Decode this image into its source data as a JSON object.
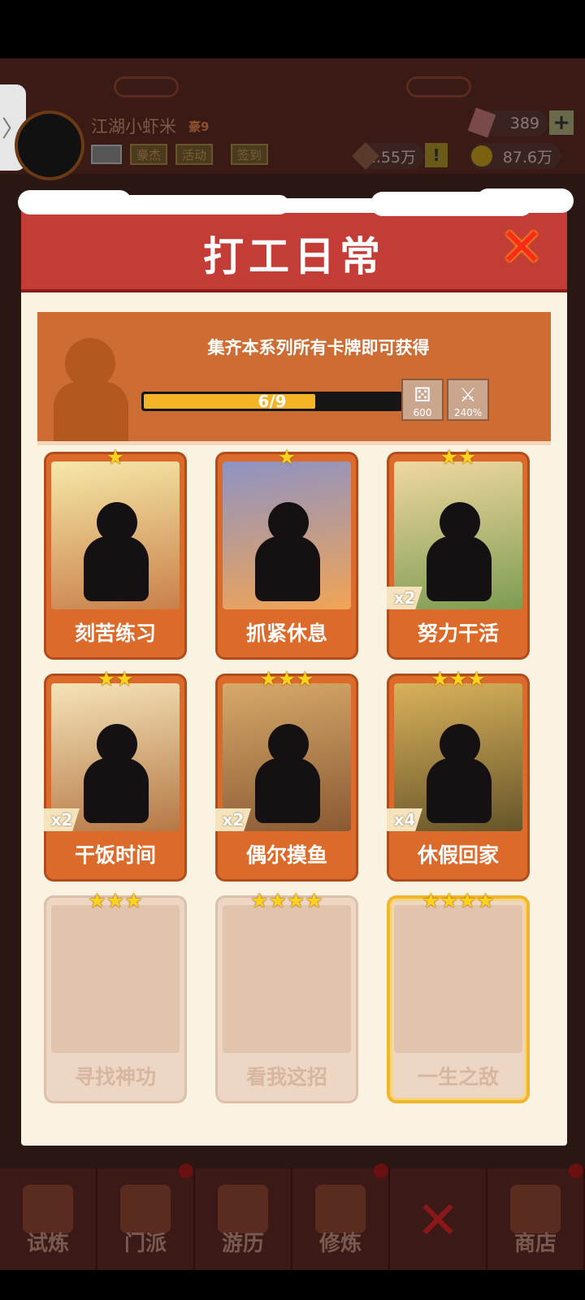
{
  "header": {
    "player_name": "江湖小虾米",
    "player_rank": "豪9",
    "buttons": [
      "豪杰",
      "活动",
      "签到"
    ],
    "gems": "389",
    "power": "1.55万",
    "coins": "87.6万",
    "plus_label": "+",
    "warn_label": "!",
    "side_tab": "〉"
  },
  "modal": {
    "title": "打工日常",
    "close_glyph": "✕",
    "banner_text": "集齐本系列所有卡牌即可获得",
    "progress": {
      "text": "6/9",
      "fraction": 0.6667
    },
    "rewards": [
      {
        "icon": "dice-icon",
        "glyph": "⚄",
        "value": "600"
      },
      {
        "icon": "sword-icon",
        "glyph": "⚔",
        "value": "240%"
      }
    ]
  },
  "cards": [
    {
      "name": "刻苦练习",
      "stars": "★",
      "mult": "",
      "state": "owned",
      "colors": [
        "#f6e8a8",
        "#c9804a"
      ]
    },
    {
      "name": "抓紧休息",
      "stars": "★",
      "mult": "",
      "state": "owned",
      "colors": [
        "#8e93c4",
        "#f1a455"
      ]
    },
    {
      "name": "努力干活",
      "stars": "★★",
      "mult": "x2",
      "state": "owned",
      "colors": [
        "#f0d7a0",
        "#7d9c52"
      ]
    },
    {
      "name": "干饭时间",
      "stars": "★★",
      "mult": "x2",
      "state": "owned",
      "colors": [
        "#f5e3b8",
        "#b57845"
      ]
    },
    {
      "name": "偶尔摸鱼",
      "stars": "★★★",
      "mult": "x2",
      "state": "owned",
      "colors": [
        "#d6a96a",
        "#8a5a33"
      ]
    },
    {
      "name": "休假回家",
      "stars": "★★★",
      "mult": "x4",
      "state": "owned",
      "colors": [
        "#d9b15a",
        "#66552a"
      ]
    },
    {
      "name": "寻找神功",
      "stars": "★★★",
      "mult": "",
      "state": "locked",
      "colors": [
        "#e2c4ad",
        "#e2c4ad"
      ]
    },
    {
      "name": "看我这招",
      "stars": "★★★★",
      "mult": "",
      "state": "locked",
      "colors": [
        "#e2c4ad",
        "#e2c4ad"
      ]
    },
    {
      "name": "一生之敌",
      "stars": "★★★★",
      "mult": "",
      "state": "locked-gold",
      "colors": [
        "#e2c4ad",
        "#e2c4ad"
      ]
    }
  ],
  "nav": [
    {
      "label": "试炼",
      "dot": false
    },
    {
      "label": "门派",
      "dot": true
    },
    {
      "label": "游历",
      "dot": false
    },
    {
      "label": "修炼",
      "dot": true
    },
    {
      "label": "",
      "dot": false,
      "close": true
    },
    {
      "label": "商店",
      "dot": true
    }
  ],
  "colors": {
    "modal_header": "#c33c35",
    "banner": "#cd6c33",
    "card_frame": "#db6a2b",
    "star": "#ffd21e",
    "progress_fill": "#f5b326"
  }
}
